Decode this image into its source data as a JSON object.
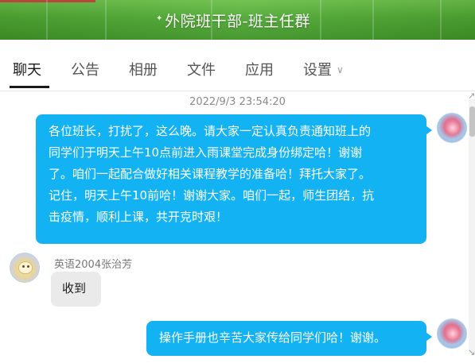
{
  "window": {
    "title": "外院班干部-班主任群"
  },
  "tabs": [
    {
      "label": "聊天",
      "active": true
    },
    {
      "label": "公告",
      "active": false
    },
    {
      "label": "相册",
      "active": false
    },
    {
      "label": "文件",
      "active": false
    },
    {
      "label": "应用",
      "active": false
    },
    {
      "label": "设置",
      "active": false,
      "has_dropdown": true
    }
  ],
  "chat": {
    "timestamp": "2022/9/3 23:54:20",
    "messages": [
      {
        "direction": "outgoing",
        "avatar": "flower-avatar",
        "lines": [
          "各位班长，打扰了，这么晚。请大家一定认真负责通知班上的",
          "同学们于明天上午10点前进入雨课堂完成身份绑定哈！谢谢",
          "了。咱们一起配合做好相关课程教学的准备哈！拜托大家了。",
          "记住，明天上午10前哈！谢谢大家。咱们一起，师生团结，抗",
          "击疫情，顺利上课，共开克时艰！"
        ]
      },
      {
        "direction": "incoming",
        "avatar": "cartoon-avatar",
        "sender": "英语2004张治芳",
        "text": "收到"
      },
      {
        "direction": "outgoing",
        "avatar": "flower-avatar",
        "text": "操作手册也辛苦大家传给同学们哈！谢谢。"
      }
    ]
  },
  "colors": {
    "outgoing_bubble": "#13b3f3",
    "incoming_bubble": "#eaeaea",
    "titlebar_green": "#4fa833"
  },
  "icons": {
    "dropdown": "chevron-down-icon",
    "resize": "resize-arrow-icon"
  }
}
